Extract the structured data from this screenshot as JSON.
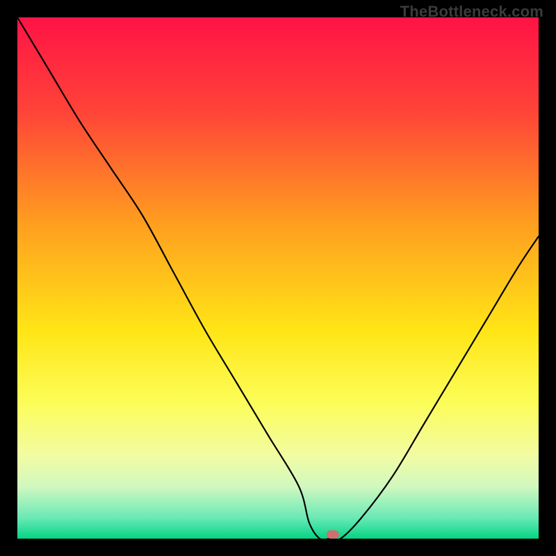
{
  "watermark": "TheBottleneck.com",
  "chart_data": {
    "type": "line",
    "title": "",
    "xlabel": "",
    "ylabel": "",
    "xlim": [
      0,
      100
    ],
    "ylim": [
      0,
      100
    ],
    "series": [
      {
        "name": "bottleneck-curve",
        "x": [
          0,
          6,
          12,
          18,
          24,
          30,
          36,
          42,
          48,
          54,
          56,
          58,
          60,
          62,
          66,
          72,
          78,
          84,
          90,
          96,
          100
        ],
        "values": [
          100,
          90,
          80,
          71,
          62,
          51,
          40,
          30,
          20,
          10,
          3,
          0,
          0,
          0,
          4,
          12,
          22,
          32,
          42,
          52,
          58
        ]
      }
    ],
    "marker": {
      "x": 60.5,
      "y": 0.8,
      "color": "#cf706f"
    },
    "background_gradient": {
      "stops": [
        {
          "pct": 0,
          "color": "#ff1345"
        },
        {
          "pct": 18,
          "color": "#ff4338"
        },
        {
          "pct": 40,
          "color": "#ffa01f"
        },
        {
          "pct": 60,
          "color": "#ffe516"
        },
        {
          "pct": 74,
          "color": "#fcfd59"
        },
        {
          "pct": 84,
          "color": "#f2fca2"
        },
        {
          "pct": 90,
          "color": "#d1f8bf"
        },
        {
          "pct": 96,
          "color": "#6ae9b6"
        },
        {
          "pct": 100,
          "color": "#04d585"
        }
      ]
    }
  }
}
